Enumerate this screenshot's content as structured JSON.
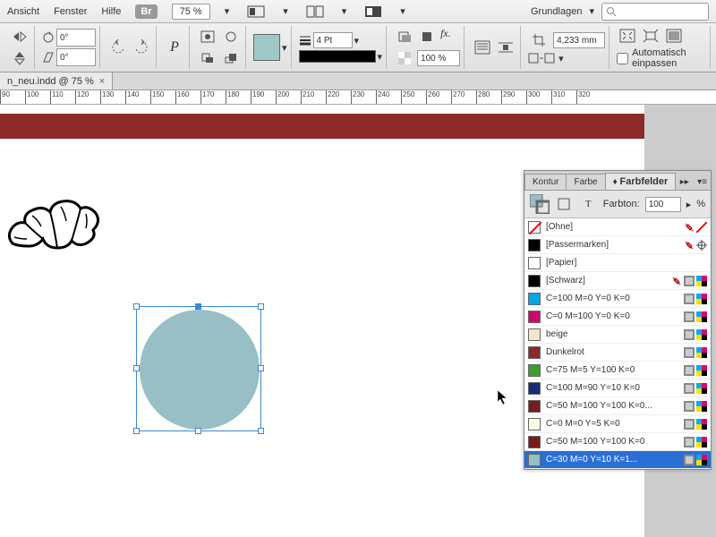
{
  "menu": {
    "items": [
      "Ansicht",
      "Fenster",
      "Hilfe"
    ],
    "br": "Br",
    "zoom": "75 %",
    "workspace": "Grundlagen"
  },
  "toolbar": {
    "deg1": "0°",
    "deg2": "0°",
    "stroke_weight": "4 Pt",
    "opacity": "100 %",
    "dim": "4,233 mm",
    "autofit": "Automatisch einpassen"
  },
  "tab": {
    "name": "n_neu.indd @ 75 %"
  },
  "ruler": {
    "marks": [
      "90",
      "100",
      "110",
      "120",
      "130",
      "140",
      "150",
      "160",
      "170",
      "180",
      "190",
      "200",
      "210",
      "220",
      "230",
      "240",
      "250",
      "260",
      "270",
      "280",
      "290",
      "300",
      "310",
      "320"
    ]
  },
  "panel": {
    "tabs": [
      "Kontur",
      "Farbe",
      "Farbfelder"
    ],
    "tint_label": "Farbton:",
    "tint_value": "100",
    "tint_unit": "%",
    "swatches": [
      {
        "name": "[Ohne]",
        "color": "#ffffff",
        "none": true,
        "locked": true,
        "reg": false
      },
      {
        "name": "[Passermarken]",
        "color": "#000000",
        "locked": true,
        "reg": true
      },
      {
        "name": "[Papier]",
        "color": "#ffffff"
      },
      {
        "name": "[Schwarz]",
        "color": "#000000",
        "locked": true,
        "cmyk": true
      },
      {
        "name": "C=100 M=0 Y=0 K=0",
        "color": "#00a5e3",
        "cmyk": true
      },
      {
        "name": "C=0 M=100 Y=0 K=0",
        "color": "#d6006d",
        "cmyk": true
      },
      {
        "name": "beige",
        "color": "#f4e8c8",
        "cmyk": true
      },
      {
        "name": "Dunkelrot",
        "color": "#8c2a2a",
        "cmyk": true
      },
      {
        "name": "C=75 M=5 Y=100 K=0",
        "color": "#3f9b33",
        "cmyk": true
      },
      {
        "name": "C=100 M=90 Y=10 K=0",
        "color": "#1a2a7a",
        "cmyk": true
      },
      {
        "name": "C=50 M=100 Y=100 K=0...",
        "color": "#7a1c1c",
        "cmyk": true
      },
      {
        "name": "C=0 M=0 Y=5 K=0",
        "color": "#fefce8",
        "cmyk": true
      },
      {
        "name": "C=50 M=100 Y=100 K=0",
        "color": "#7a1c1c",
        "cmyk": true
      },
      {
        "name": "C=30 M=0 Y=10 K=1...",
        "color": "#97bfc5",
        "cmyk": true,
        "selected": true
      }
    ]
  }
}
